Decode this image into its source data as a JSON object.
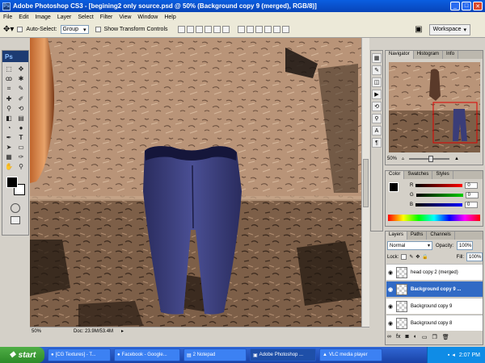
{
  "window": {
    "title": "Adobe Photoshop CS3 - [begining2 only source.psd @ 50% (Background copy 9 (merged), RGB/8)]",
    "app_icon": "Ps"
  },
  "menu": [
    "File",
    "Edit",
    "Image",
    "Layer",
    "Select",
    "Filter",
    "View",
    "Window",
    "Help"
  ],
  "options": {
    "auto_select_label": "Auto-Select:",
    "auto_select_value": "Group",
    "transform_label": "Show Transform Controls",
    "workspace_label": "Workspace"
  },
  "toolbox": {
    "logo": "Ps"
  },
  "document": {
    "zoom": "50%",
    "doc_info": "Doc: 23.9M/53.4M"
  },
  "navigator": {
    "tabs": [
      "Navigator",
      "Histogram",
      "Info"
    ],
    "zoom": "50%"
  },
  "color_panel": {
    "tabs": [
      "Color",
      "Swatches",
      "Styles"
    ],
    "channels": [
      {
        "label": "R",
        "value": "0",
        "color": "#ff0000"
      },
      {
        "label": "G",
        "value": "0",
        "color": "#00c000"
      },
      {
        "label": "B",
        "value": "0",
        "color": "#0000ff"
      }
    ]
  },
  "layers_panel": {
    "tabs": [
      "Layers",
      "Paths",
      "Channels"
    ],
    "blend_mode": "Normal",
    "opacity_label": "Opacity:",
    "opacity": "100%",
    "lock_label": "Lock:",
    "fill_label": "Fill:",
    "fill": "100%",
    "layers": [
      {
        "name": "head copy 2 (merged)",
        "selected": false
      },
      {
        "name": "Background copy 9 ...",
        "selected": true
      },
      {
        "name": "Background copy 9",
        "selected": false
      },
      {
        "name": "Background copy 8",
        "selected": false
      }
    ]
  },
  "taskbar": {
    "start_label": "start",
    "tasks": [
      {
        "label": "[CG Textures] - T...",
        "active": false
      },
      {
        "label": "Facebook - Google...",
        "active": false
      },
      {
        "label": "2 Notepad",
        "active": false
      },
      {
        "label": "Adobe Photoshop ...",
        "active": true
      },
      {
        "label": "VLC media player",
        "active": false
      }
    ],
    "clock": "2:07 PM"
  },
  "colors": {
    "title_blue": "#0a5ee0",
    "taskbar_blue": "#245edb",
    "selection_blue": "#316ac5",
    "rock_tan": "#b99478",
    "jeans_blue": "#3a3d78"
  }
}
